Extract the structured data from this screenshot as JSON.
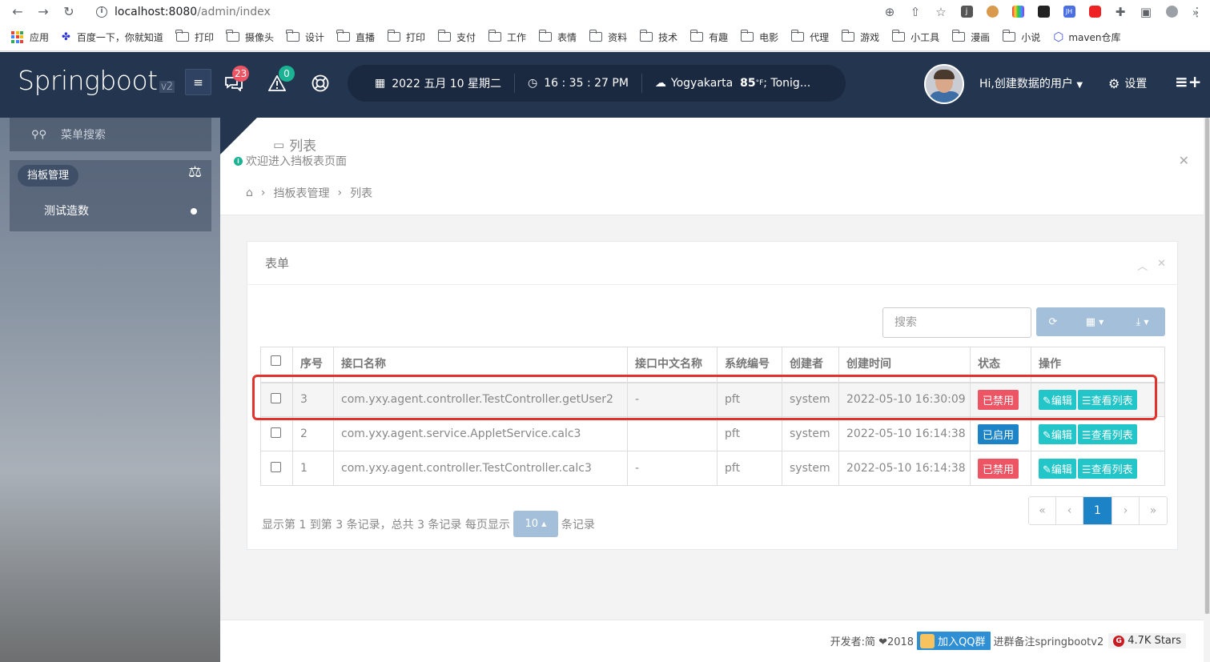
{
  "browser": {
    "url_host": "localhost:8080",
    "url_path": "/admin/index"
  },
  "bookmarks": {
    "items": [
      "应用",
      "百度一下，你就知道",
      "打印",
      "摄像头",
      "设计",
      "直播",
      "打印",
      "支付",
      "工作",
      "表情",
      "资料",
      "技术",
      "有趣",
      "电影",
      "代理",
      "游戏",
      "小工具",
      "漫画",
      "小说",
      "maven仓库"
    ],
    "more": "»"
  },
  "header": {
    "logo": "Springboot",
    "logo_version": "v2",
    "messages_badge": "23",
    "alerts_badge": "0",
    "date": "2022 五月 10 星期二",
    "time": "16 : 35 : 27 PM",
    "weather_city": "Yogyakarta",
    "weather_temp": "85",
    "weather_unit": "°F",
    "weather_rest": " ; Tonig...",
    "user_greeting": "Hi,创建数据的用户",
    "settings_label": "设置",
    "colors": {
      "header_bg": "#24354f",
      "pill_bg": "#1a2840",
      "badge_red": "#ed5565",
      "badge_teal": "#1ab394"
    }
  },
  "sidebar": {
    "search_placeholder": "菜单搜索",
    "group_label": "挡板管理",
    "item_label": "测试造数"
  },
  "page": {
    "title": "列表",
    "subtitle": "欢迎进入挡板表页面",
    "breadcrumb": [
      "挡板表管理",
      "列表"
    ]
  },
  "panel": {
    "title": "表单",
    "search_placeholder": "搜索"
  },
  "table": {
    "columns": [
      "序号",
      "接口名称",
      "接口中文名称",
      "系统编号",
      "创建者",
      "创建时间",
      "状态",
      "操作"
    ],
    "rows": [
      {
        "seq": "3",
        "name": "com.yxy.agent.controller.TestController.getUser2",
        "cn_name": "-",
        "system": "pft",
        "creator": "system",
        "created": "2022-05-10 16:30:09",
        "status": "已禁用",
        "status_color": "#ed5565"
      },
      {
        "seq": "2",
        "name": "com.yxy.agent.service.AppletService.calc3",
        "cn_name": "",
        "system": "pft",
        "creator": "system",
        "created": "2022-05-10 16:14:38",
        "status": "已启用",
        "status_color": "#1c84c6"
      },
      {
        "seq": "1",
        "name": "com.yxy.agent.controller.TestController.calc3",
        "cn_name": "-",
        "system": "pft",
        "creator": "system",
        "created": "2022-05-10 16:14:38",
        "status": "已禁用",
        "status_color": "#ed5565"
      }
    ],
    "action_edit": "编辑",
    "action_list": "查看列表"
  },
  "pager": {
    "info_prefix": "显示第 1 到第 3 条记录，总共 3 条记录 每页显示",
    "page_size": "10",
    "info_suffix": "条记录",
    "first": "«",
    "prev": "‹",
    "current": "1",
    "next": "›",
    "last": "»"
  },
  "footer": {
    "developer": "开发者:简 ❤2018",
    "qq_label": "加入QQ群",
    "note": "进群备注springbootv2",
    "stars": "4.7K Stars"
  }
}
